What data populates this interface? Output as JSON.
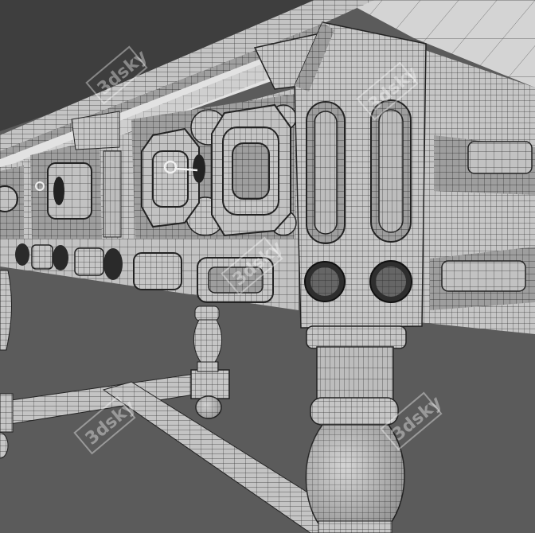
{
  "image": {
    "subject": "wireframe-render-carved-table",
    "colors": {
      "background": "#5b5b5b",
      "surface": "#c9c9c9",
      "surface_dark": "#a8a8a8",
      "wire": "#2a2a2a",
      "top_surface": "#d6d6d6",
      "top_background": "#3c3c3c"
    }
  },
  "watermarks": [
    {
      "text": "3dsky"
    },
    {
      "text": "3dsky"
    },
    {
      "text": "3dsky"
    },
    {
      "text": "3dsky"
    },
    {
      "text": "3dsky"
    }
  ]
}
